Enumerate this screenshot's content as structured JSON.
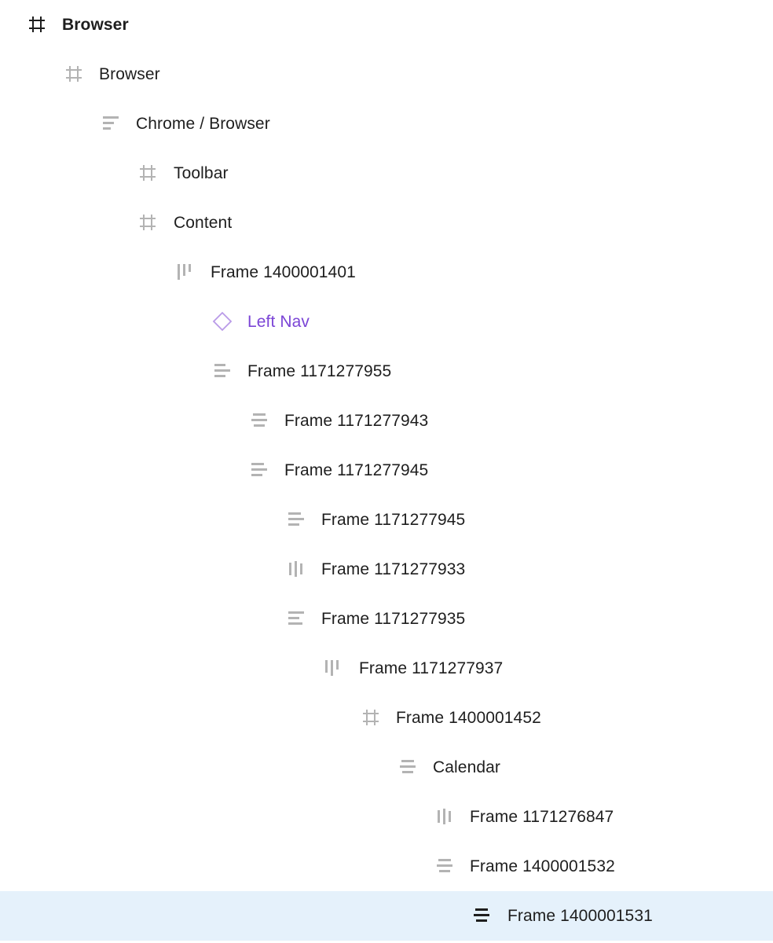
{
  "colors": {
    "text": "#1e1e1e",
    "icon_muted": "#b3b3b3",
    "icon_strong": "#1e1e1e",
    "component": "#7b45d6",
    "component_icon": "#b99ae8",
    "selected_bg": "#e5f1fb"
  },
  "layers": [
    {
      "label": "Browser",
      "icon": "frame-icon",
      "depth": 0,
      "bold": true
    },
    {
      "label": "Browser",
      "icon": "frame-icon",
      "depth": 1
    },
    {
      "label": "Chrome / Browser",
      "icon": "auto-layout-vertical-icon",
      "depth": 2
    },
    {
      "label": "Toolbar",
      "icon": "frame-icon",
      "depth": 3
    },
    {
      "label": "Content",
      "icon": "frame-icon",
      "depth": 3
    },
    {
      "label": "Frame 1400001401",
      "icon": "auto-layout-horizontal-icon",
      "depth": 4
    },
    {
      "label": "Left Nav",
      "icon": "component-instance-icon",
      "depth": 5,
      "component": true
    },
    {
      "label": "Frame 1171277955",
      "icon": "auto-layout-vertical-icon",
      "depth": 5
    },
    {
      "label": "Frame 1171277943",
      "icon": "auto-layout-vertical-center-icon",
      "depth": 6
    },
    {
      "label": "Frame 1171277945",
      "icon": "auto-layout-vertical-icon",
      "depth": 6
    },
    {
      "label": "Frame 1171277945",
      "icon": "auto-layout-vertical-icon",
      "depth": 7
    },
    {
      "label": "Frame 1171277933",
      "icon": "auto-layout-horizontal-center-icon",
      "depth": 7
    },
    {
      "label": "Frame 1171277935",
      "icon": "auto-layout-vertical-icon",
      "depth": 7
    },
    {
      "label": "Frame 1171277937",
      "icon": "auto-layout-horizontal-icon",
      "depth": 8
    },
    {
      "label": "Frame 1400001452",
      "icon": "frame-icon",
      "depth": 9
    },
    {
      "label": "Calendar",
      "icon": "auto-layout-vertical-center-icon",
      "depth": 10
    },
    {
      "label": "Frame 1171276847",
      "icon": "auto-layout-horizontal-center-icon",
      "depth": 11
    },
    {
      "label": "Frame 1400001532",
      "icon": "auto-layout-vertical-center-icon",
      "depth": 11
    },
    {
      "label": "Frame 1400001531",
      "icon": "auto-layout-vertical-center-icon",
      "depth": 12,
      "selected": true
    }
  ]
}
